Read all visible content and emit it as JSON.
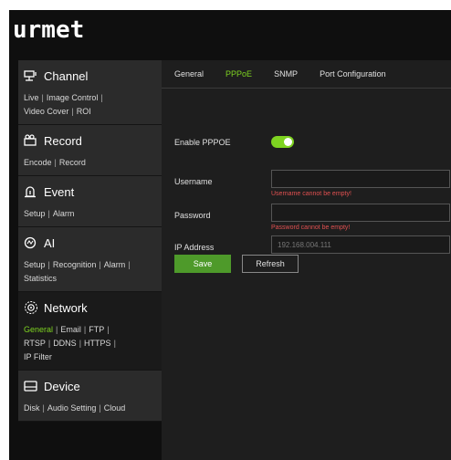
{
  "brand": {
    "logo_text": "urmet"
  },
  "sidebar": {
    "sections": [
      {
        "title": "Channel",
        "icon": "channel-icon",
        "links": [
          "Live",
          "Image Control",
          "Video Cover",
          "ROI"
        ]
      },
      {
        "title": "Record",
        "icon": "record-icon",
        "links": [
          "Encode",
          "Record"
        ]
      },
      {
        "title": "Event",
        "icon": "event-icon",
        "links": [
          "Setup",
          "Alarm"
        ]
      },
      {
        "title": "AI",
        "icon": "ai-icon",
        "links": [
          "Setup",
          "Recognition",
          "Alarm",
          "Statistics"
        ]
      },
      {
        "title": "Network",
        "icon": "network-icon",
        "links": [
          "General",
          "Email",
          "FTP",
          "RTSP",
          "DDNS",
          "HTTPS",
          "IP Filter"
        ],
        "active_link": "General"
      },
      {
        "title": "Device",
        "icon": "device-icon",
        "links": [
          "Disk",
          "Audio Setting",
          "Cloud"
        ]
      }
    ]
  },
  "tabs": [
    {
      "label": "General",
      "active": false
    },
    {
      "label": "PPPoE",
      "active": true
    },
    {
      "label": "SNMP",
      "active": false
    },
    {
      "label": "Port Configuration",
      "active": false
    }
  ],
  "form": {
    "enable_label": "Enable PPPOE",
    "enable_on": true,
    "username_label": "Username",
    "username_value": "",
    "username_error": "Username cannot be empty!",
    "password_label": "Password",
    "password_value": "",
    "password_error": "Password cannot be empty!",
    "ip_label": "IP Address",
    "ip_value": "192.168.004.111"
  },
  "buttons": {
    "save": "Save",
    "refresh": "Refresh"
  },
  "colors": {
    "accent": "#7ed321",
    "error": "#e05050",
    "save_bg": "#4e9a2a"
  }
}
